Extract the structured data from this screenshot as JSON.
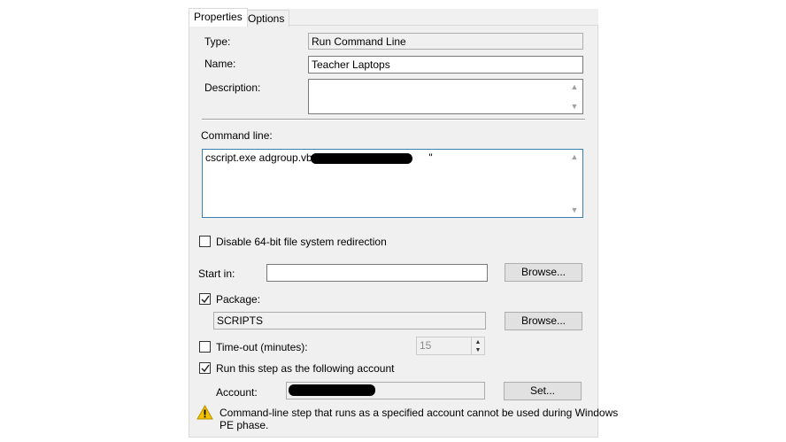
{
  "tabs": [
    {
      "label": "Properties",
      "active": true
    },
    {
      "label": "Options",
      "active": false
    }
  ],
  "properties": {
    "type_label": "Type:",
    "type_value": "Run Command Line",
    "name_label": "Name:",
    "name_value": "Teacher Laptops",
    "description_label": "Description:",
    "description_value": "",
    "command_line_label": "Command line:",
    "command_line_value": "cscript.exe adgroup.vbs \"",
    "command_line_suffix": "\"",
    "disable_redirection_label": "Disable 64-bit file system redirection",
    "disable_redirection_checked": false,
    "start_in_label": "Start in:",
    "start_in_value": "",
    "browse_label": "Browse...",
    "package_label": "Package:",
    "package_checked": true,
    "package_value": "SCRIPTS",
    "timeout_label": "Time-out (minutes):",
    "timeout_checked": false,
    "timeout_value": "15",
    "run_as_label": "Run this step as the following account",
    "run_as_checked": true,
    "account_label": "Account:",
    "set_label": "Set...",
    "warning_line1": "Command-line step that runs as a specified account cannot be used during Windows",
    "warning_line2": "PE phase."
  },
  "icons": {
    "scroll_up": "chevron-up-icon",
    "scroll_down": "chevron-down-icon",
    "check": "checkmark-icon",
    "warning": "warning-triangle-icon"
  },
  "colors": {
    "panel": "#f0f0f0",
    "focus_border": "#3c7fb1",
    "warning": "#f2c200"
  }
}
